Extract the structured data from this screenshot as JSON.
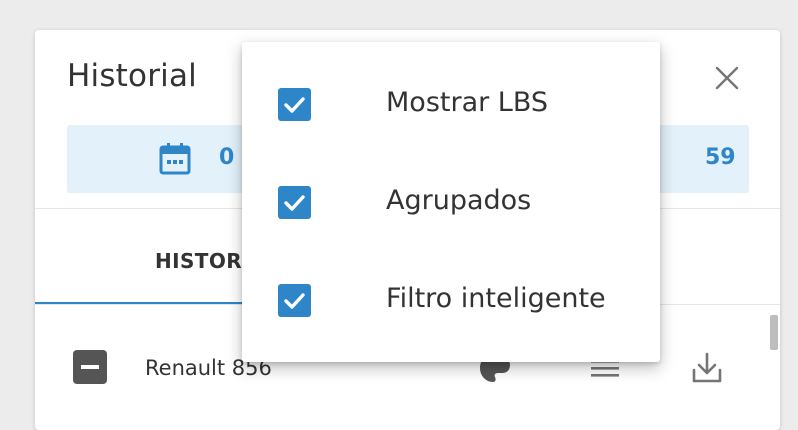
{
  "panel": {
    "title": "Historial",
    "close_icon": "close-icon",
    "date_range": {
      "start_partial": "0",
      "end_partial": "59",
      "icon": "calendar-icon"
    },
    "tabs": [
      {
        "label": "HISTORIAL",
        "active": true
      }
    ],
    "rows": [
      {
        "name": "Renault 856",
        "selected_state": "indeterminate",
        "icons": [
          "palette-icon",
          "menu-icon",
          "download-icon"
        ]
      }
    ]
  },
  "menu": {
    "options": [
      {
        "label": "Mostrar LBS",
        "checked": true
      },
      {
        "label": "Agrupados",
        "checked": true
      },
      {
        "label": "Filtro inteligente",
        "checked": true
      }
    ]
  },
  "colors": {
    "accent": "#2e86c9",
    "date_bg": "#e3f1fb",
    "text": "#333333"
  }
}
